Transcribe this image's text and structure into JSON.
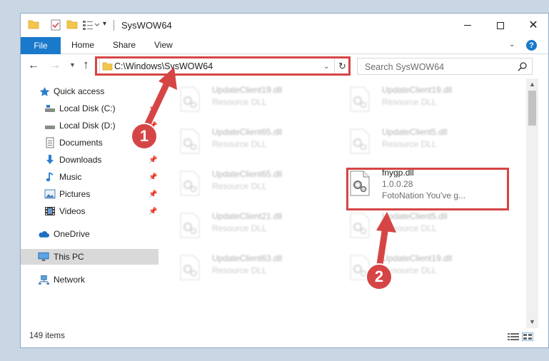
{
  "window": {
    "title": "SysWOW64",
    "tabs": [
      "File",
      "Home",
      "Share",
      "View"
    ]
  },
  "address": {
    "path": "C:\\Windows\\SysWOW64",
    "search_placeholder": "Search SysWOW64"
  },
  "sidebar": {
    "items": [
      {
        "label": "Quick access",
        "icon": "star-icon",
        "pinned": false
      },
      {
        "label": "Local Disk (C:)",
        "icon": "drive-icon",
        "pinned": true
      },
      {
        "label": "Local Disk (D:)",
        "icon": "drive-icon",
        "pinned": true
      },
      {
        "label": "Documents",
        "icon": "documents-icon",
        "pinned": true
      },
      {
        "label": "Downloads",
        "icon": "download-icon",
        "pinned": true
      },
      {
        "label": "Music",
        "icon": "music-icon",
        "pinned": true
      },
      {
        "label": "Pictures",
        "icon": "pictures-icon",
        "pinned": true
      },
      {
        "label": "Videos",
        "icon": "videos-icon",
        "pinned": true
      },
      {
        "label": "OneDrive",
        "icon": "cloud-icon",
        "pinned": false
      },
      {
        "label": "This PC",
        "icon": "pc-icon",
        "pinned": false,
        "selected": true
      },
      {
        "label": "Network",
        "icon": "network-icon",
        "pinned": false
      }
    ]
  },
  "files": [
    {
      "name": "UpdateClient19.dll",
      "desc": "Resource DLL"
    },
    {
      "name": "UpdateClient19.dll",
      "desc": "Resource DLL"
    },
    {
      "name": "UpdateClient65.dll",
      "desc": "Resource DLL"
    },
    {
      "name": "UpdateClient5.dll",
      "desc": "Resource DLL"
    },
    {
      "name": "UpdateClient65.dll",
      "desc": "Resource DLL"
    },
    {
      "name": "fnygp.dll",
      "version": "1.0.0.28",
      "desc": "FotoNation You've g..."
    },
    {
      "name": "UpdateClient21.dll",
      "desc": "Resource DLL"
    },
    {
      "name": "UpdateClient5.dll",
      "desc": "Resource DLL"
    },
    {
      "name": "UpdateClient63.dll",
      "desc": "Resource DLL"
    },
    {
      "name": "UpdateClient19.dll",
      "desc": "Resource DLL"
    }
  ],
  "status": {
    "item_count": "149 items"
  },
  "annotations": {
    "step1": "1",
    "step2": "2"
  },
  "colors": {
    "accent": "#1979ca",
    "annotation": "#d64545",
    "folder": "#f3c54a"
  }
}
